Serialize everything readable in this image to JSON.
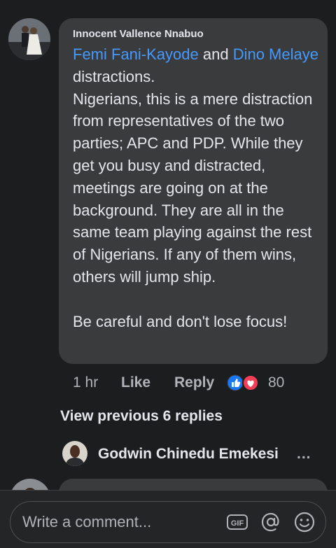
{
  "comment": {
    "author": "Innocent Vallence Nnabuo",
    "mention_1": "Femi Fani-Kayode",
    "joiner": " and ",
    "mention_2": "Dino Melaye",
    "text": " distractions.\nNigerians, this is a mere distraction from representatives of the two parties; APC and PDP. While they get you busy and distracted, meetings are going on at the background. They are all in the same team playing against the rest of Nigerians. If any of them wins, others will jump ship.\n\nBe careful and don't lose focus!",
    "time": "1 hr",
    "like_label": "Like",
    "reply_label": "Reply",
    "reaction_count": "80",
    "reactions": [
      "like-icon",
      "love-icon"
    ]
  },
  "replies": {
    "view_previous_label": "View previous 6 replies",
    "latest_author": "Godwin Chinedu Emekesi",
    "more_indicator": "..."
  },
  "composer": {
    "placeholder": "Write a comment..."
  },
  "colors": {
    "background": "#1c1d1f",
    "bubble": "#3a3b3c",
    "mention": "#4599ff",
    "like_blue": "#1877f2",
    "love_red": "#f33e58"
  }
}
